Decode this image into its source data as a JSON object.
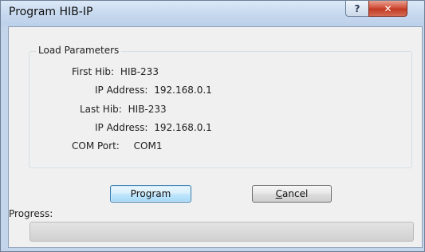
{
  "window": {
    "title": "Program HIB-IP",
    "help_glyph": "?",
    "close_glyph": "✕"
  },
  "group": {
    "legend": "Load Parameters",
    "first_hib_label": "First Hib:",
    "first_hib_value": "HIB-233",
    "first_ip_label": "IP Address:",
    "first_ip_value": "192.168.0.1",
    "last_hib_label": "Last Hib:",
    "last_hib_value": "HIB-233",
    "last_ip_label": "IP Address:",
    "last_ip_value": "192.168.0.1",
    "com_port_label": "COM Port:",
    "com_port_value": "COM1"
  },
  "buttons": {
    "program_label": "Program",
    "cancel_mnemonic": "C",
    "cancel_rest": "ancel"
  },
  "progress": {
    "label": "Progress:",
    "value": 0
  },
  "colors": {
    "close_button": "#c9432c",
    "default_button_border": "#3c7fb1"
  }
}
